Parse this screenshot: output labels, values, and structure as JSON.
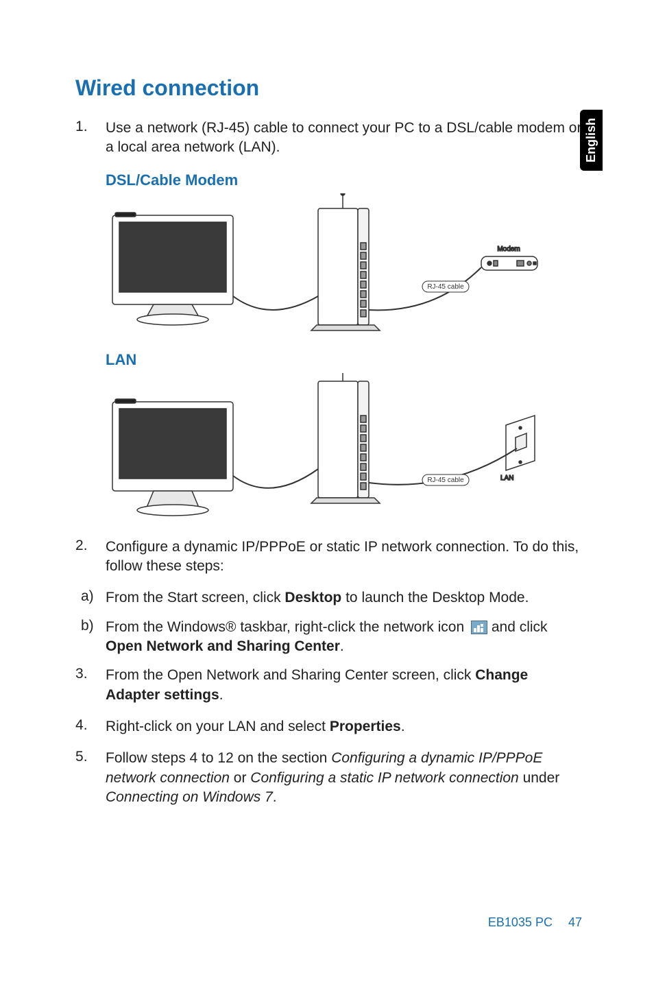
{
  "language_tab": "English",
  "section_title": "Wired connection",
  "steps": [
    {
      "n": "1.",
      "text_parts": [
        {
          "t": "Use a network (RJ-45) cable to connect your PC to a DSL/cable modem or a local area network (LAN)."
        }
      ]
    },
    {
      "n": "2.",
      "text_parts": [
        {
          "t": "Configure a dynamic IP/PPPoE or static IP network connection. To do this, follow these steps:"
        }
      ]
    },
    {
      "n": "3.",
      "text_parts": [
        {
          "t": "From the Open Network and Sharing Center screen, click "
        },
        {
          "t": "Change Adapter settings",
          "bold": true
        },
        {
          "t": "."
        }
      ]
    },
    {
      "n": "4.",
      "text_parts": [
        {
          "t": "Right-click on your LAN and select "
        },
        {
          "t": "Properties",
          "bold": true
        },
        {
          "t": "."
        }
      ]
    },
    {
      "n": "5.",
      "text_parts": [
        {
          "t": "Follow steps 4 to 12 on the section "
        },
        {
          "t": "Configuring a dynamic IP/PPPoE network connection",
          "italic": true
        },
        {
          "t": " or "
        },
        {
          "t": "Configuring a static IP network connection",
          "italic": true
        },
        {
          "t": " under "
        },
        {
          "t": "Connecting on Windows 7",
          "italic": true
        },
        {
          "t": "."
        }
      ]
    }
  ],
  "substeps": [
    {
      "m": "a)",
      "text_parts": [
        {
          "t": "From the Start screen, click "
        },
        {
          "t": "Desktop",
          "bold": true
        },
        {
          "t": " to launch the Desktop Mode."
        }
      ]
    },
    {
      "m": "b)",
      "has_icon": true,
      "text_parts_before": [
        {
          "t": "From the Windows® taskbar, right-click the network icon "
        }
      ],
      "text_parts_after": [
        {
          "t": " and click "
        },
        {
          "t": "Open Network and Sharing Center",
          "bold": true
        },
        {
          "t": "."
        }
      ]
    }
  ],
  "diagram_labels": {
    "dsl_heading": "DSL/Cable Modem",
    "lan_heading": "LAN",
    "modem": "Modem",
    "rj45": "RJ-45 cable",
    "lan_port": "LAN"
  },
  "footer": {
    "model": "EB1035 PC",
    "page": "47"
  }
}
